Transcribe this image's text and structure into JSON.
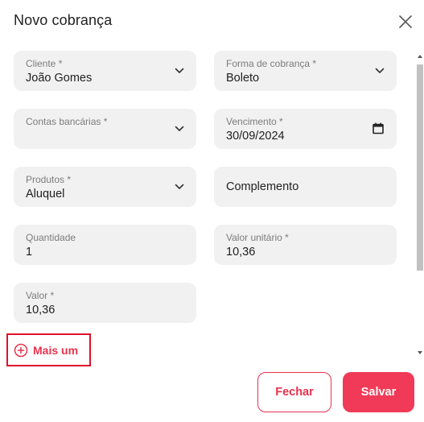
{
  "modal": {
    "title": "Novo cobrança"
  },
  "fields": {
    "cliente": {
      "label": "Cliente *",
      "value": "João Gomes"
    },
    "forma_cobranca": {
      "label": "Forma de cobrança *",
      "value": "Boleto"
    },
    "contas_bancarias": {
      "label": "Contas bancárias *",
      "value": ""
    },
    "vencimento": {
      "label": "Vencimento *",
      "value": "30/09/2024"
    },
    "produtos": {
      "label": "Produtos *",
      "value": "Aluquel"
    },
    "complemento": {
      "placeholder": "Complemento"
    },
    "quantidade": {
      "label": "Quantidade",
      "value": "1"
    },
    "valor_unitario": {
      "label": "Valor unitário *",
      "value": "10,36"
    },
    "valor": {
      "label": "Valor *",
      "value": "10,36"
    }
  },
  "actions": {
    "mais_um": "Mais um",
    "fechar": "Fechar",
    "salvar": "Salvar"
  },
  "colors": {
    "accent": "#f03a57",
    "field_bg": "#f1f1f1",
    "highlight_border": "#e0102a"
  }
}
